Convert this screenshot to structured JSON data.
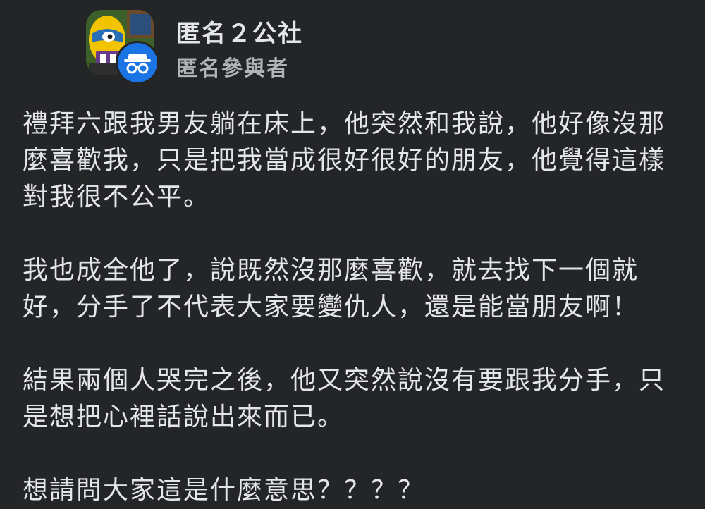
{
  "post": {
    "group_name": "匿名２公社",
    "author_name": "匿名參與者",
    "paragraphs": [
      [
        "禮拜六跟我男友躺在床上，他突然和我說，他好像沒那",
        "麼喜歡我，只是把我當成很好很好的朋友，他覺得這樣",
        "對我很不公平。"
      ],
      [
        "我也成全他了，說既然沒那麼喜歡，就去找下一個就",
        "好，分手了不代表大家要變仇人，還是能當朋友啊！"
      ],
      [
        "結果兩個人哭完之後，他又突然說沒有要跟我分手，只",
        "是想把心裡話說出來而已。"
      ],
      [
        "想請問大家這是什麼意思？？？？"
      ]
    ],
    "group_avatar_icon": "cartoon-character-icon",
    "user_badge_icon": "anonymous-incognito-icon",
    "colors": {
      "background": "#242526",
      "primary_text": "#e4e6eb",
      "secondary_text": "#b0b3b8",
      "badge_blue": "#1b74e4"
    }
  }
}
